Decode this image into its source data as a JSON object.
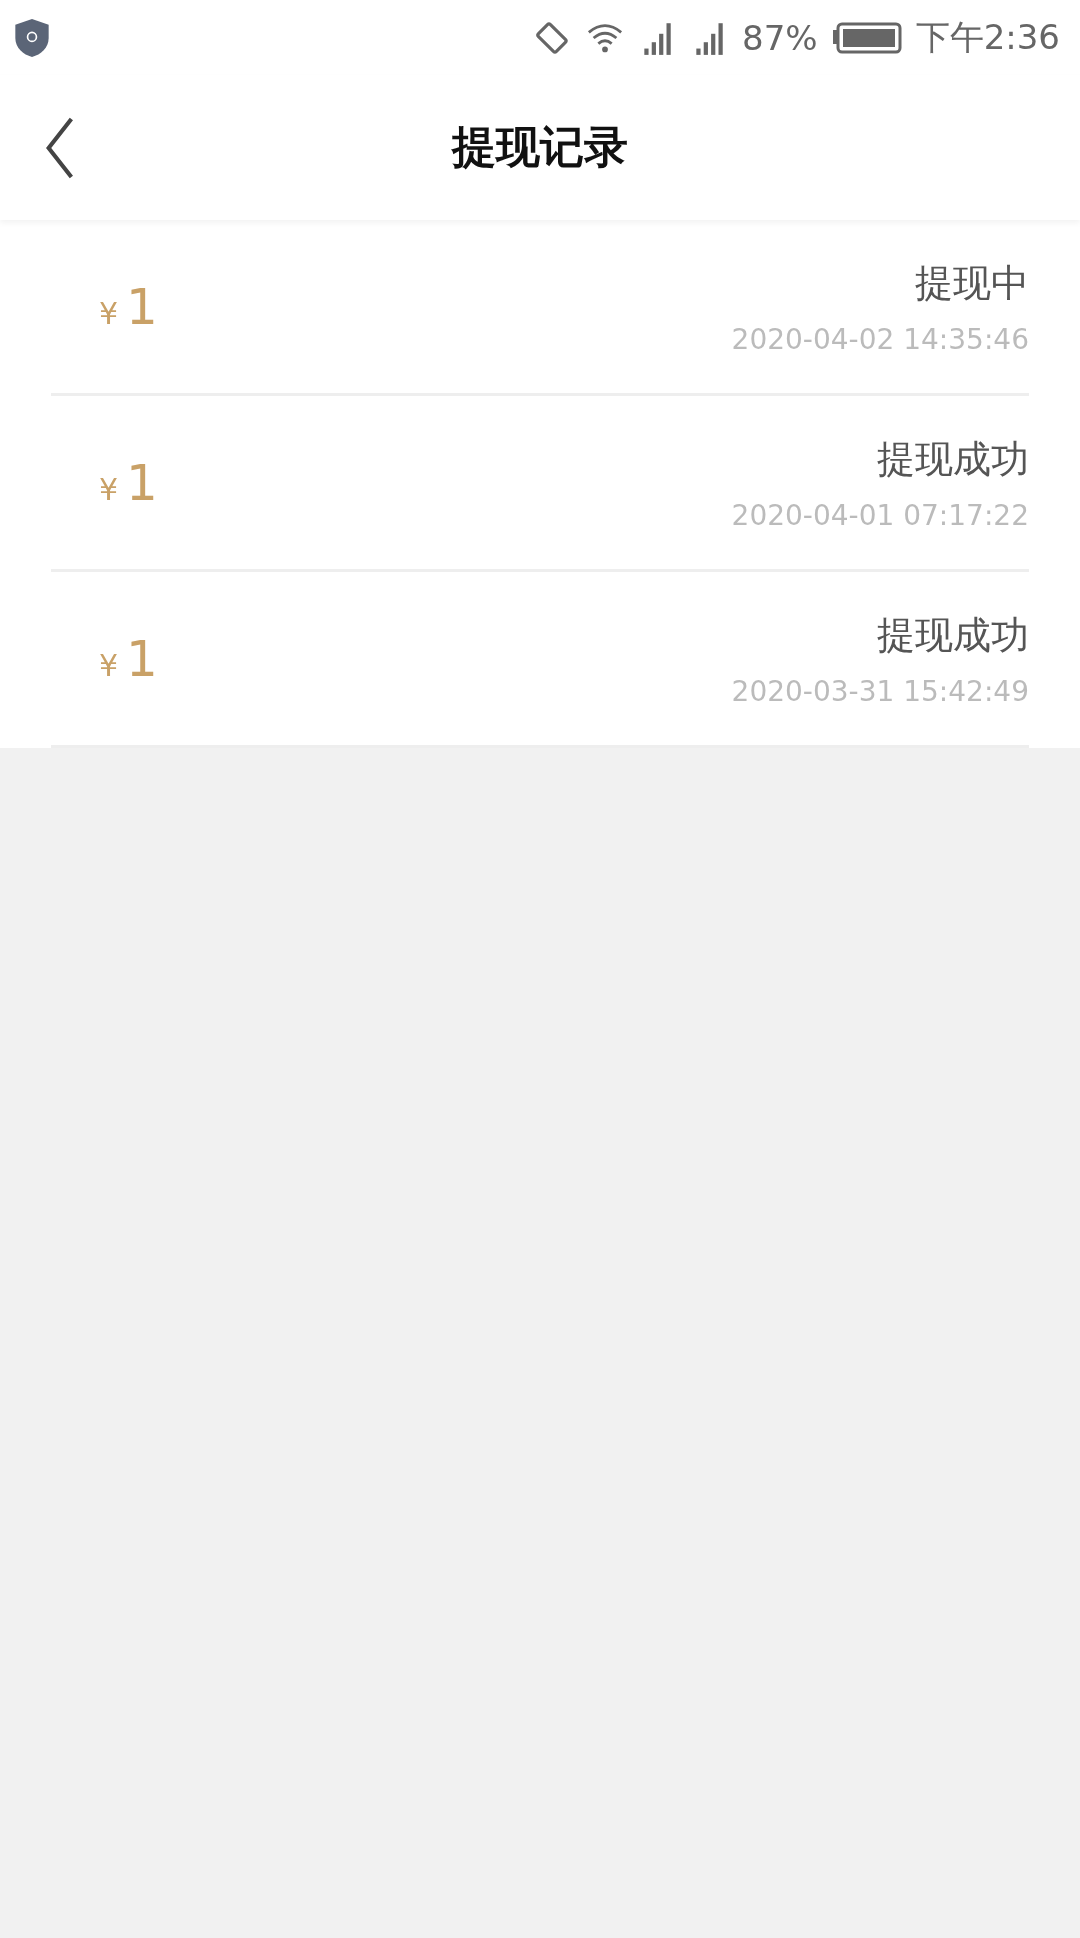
{
  "status_bar": {
    "battery": "87%",
    "time": "下午2:36"
  },
  "header": {
    "title": "提现记录"
  },
  "records": [
    {
      "currency": "¥",
      "amount": "1",
      "status": "提现中",
      "time": "2020-04-02 14:35:46"
    },
    {
      "currency": "¥",
      "amount": "1",
      "status": "提现成功",
      "time": "2020-04-01 07:17:22"
    },
    {
      "currency": "¥",
      "amount": "1",
      "status": "提现成功",
      "time": "2020-03-31 15:42:49"
    }
  ]
}
